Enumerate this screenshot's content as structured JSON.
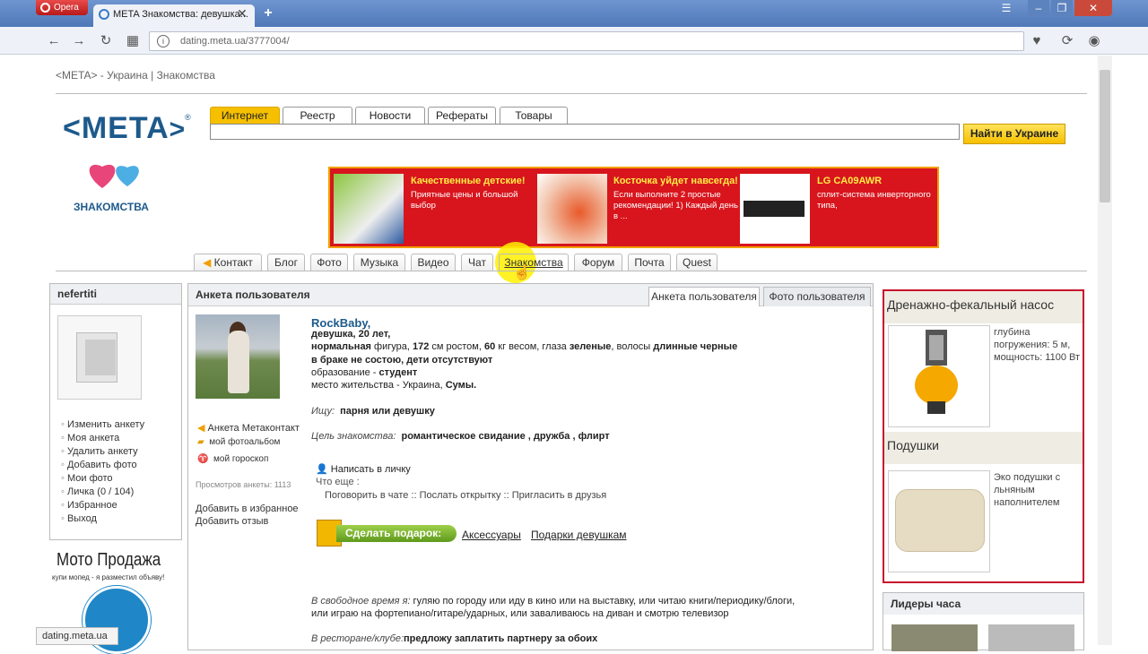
{
  "browser": {
    "menu_label": "Opera",
    "tab_title": "META Знакомства: девушка...",
    "address": "dating.meta.ua/3777004/",
    "status_url": "dating.meta.ua"
  },
  "page": {
    "breadcrumb": "<META> - Украина | Знакомства",
    "logo": "<META",
    "logo_reg": "®",
    "section_label": "ЗНАКОМСТВА",
    "search_tabs": [
      "Интернет",
      "Реестр",
      "Новости",
      "Рефераты",
      "Товары"
    ],
    "search_button": "Найти в Украине",
    "banner": [
      {
        "title": "Качественные детские!",
        "text": "Приятные цены и большой выбор"
      },
      {
        "title": "Косточка уйдет навсегда!",
        "text": "Если выполните 2 простые рекомендации! 1) Каждый день в ..."
      },
      {
        "title": "LG CA09AWR",
        "text": "сплит-система инверторного типа,"
      }
    ],
    "nav_tabs": [
      "Контакт",
      "Блог",
      "Фото",
      "Музыка",
      "Видео",
      "Чат",
      "Знакомства",
      "Форум",
      "Почта",
      "Quest"
    ]
  },
  "left": {
    "username": "nefertiti",
    "menu": [
      "Изменить анкету",
      "Моя анкета",
      "Удалить анкету",
      "Добавить фото",
      "Мои фото",
      "Личка (0 / 104)",
      "Избранное",
      "Выход"
    ],
    "ad_title": "Мото Продажа",
    "ad_sub": "купи мопед - я разместил объяву!"
  },
  "main": {
    "header": "Анкета пользователя",
    "tabs": [
      "Анкета пользователя",
      "Фото пользователя"
    ],
    "profile_links": [
      "Анкета Метаконтакт",
      "мой фотоальбом",
      "мой гороскоп"
    ],
    "views_label": "Просмотров анкеты: 1113",
    "fav_link": "Добавить в избранное",
    "review_link": "Добавить отзыв",
    "name": "RockBaby,",
    "line1": "девушка, 20 лет,",
    "line2a": "нормальная",
    "line2b": " фигура, ",
    "line2c": "172",
    "line2d": " см ростом, ",
    "line2e": "60",
    "line2f": " кг весом, глаза ",
    "line2g": "зеленые",
    "line2h": ", волосы ",
    "line2i": "длинные черные",
    "line3": "в браке не состою, дети отсутствуют",
    "line4a": "образование - ",
    "line4b": "студент",
    "line5a": "место жительства - Украина, ",
    "line5b": "Сумы.",
    "seek_label": "Ищу:",
    "seek_value": "парня или девушку",
    "goal_label": "Цель знакомства:",
    "goal_value": "романтическое свидание , дружба , флирт",
    "write_pm": "Написать в личку",
    "what_else": "Что еще :",
    "actions": "Поговорить в чате :: Послать открытку :: Пригласить в друзья",
    "gift_button": "Сделать подарок:",
    "gift_links": [
      "Аксессуары",
      "Подарки девушкам"
    ],
    "free_time_label": "В свободное время я:",
    "free_time_1": " гуляю по городу или иду в кино или на выставку, или читаю книги/периодику/блоги,",
    "free_time_2": "или играю на фортепиано/гитаре/ударных, или заваливаюсь на диван и смотрю телевизор",
    "restaurant_label": "В ресторане/клубе:",
    "restaurant_value": "предложу заплатить партнеру за обоих"
  },
  "right": {
    "ad1_title": "Дренажно-фекальный насос",
    "ad1_text": "глубина погружения: 5 м, мощность: 1100 Вт",
    "ad2_title": "Подушки",
    "ad2_text": "Эко подушки с льняным наполнителем",
    "leaders_title": "Лидеры часа"
  },
  "colors": {
    "brand": "#1d5a8c",
    "accent": "#f6c000",
    "banner": "#d8151d",
    "ad_border": "#c8102e"
  }
}
